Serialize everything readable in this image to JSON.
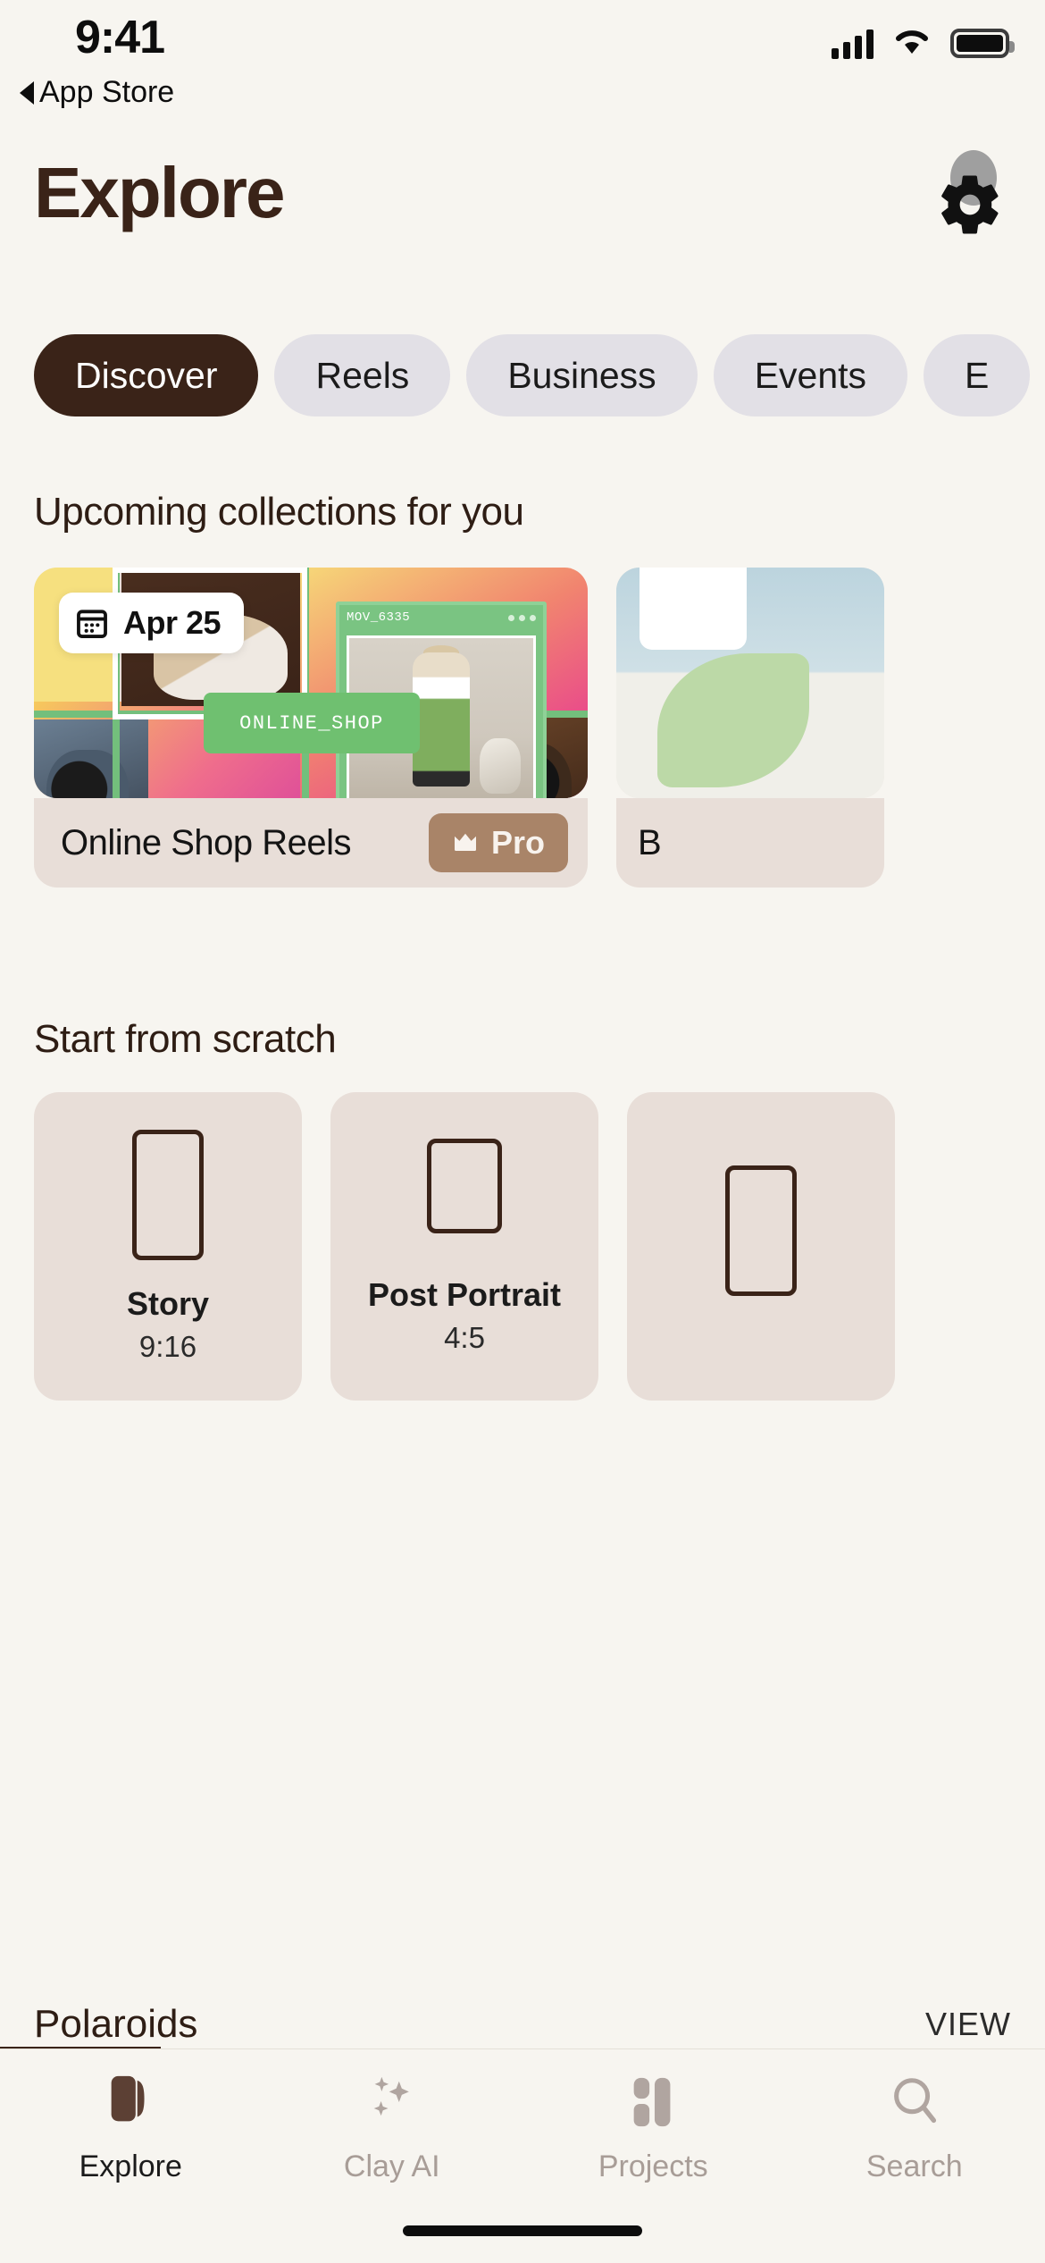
{
  "status_bar": {
    "time": "9:41",
    "back_label": "App Store",
    "back_icon": "triangle-left-icon",
    "signal_icon": "cellular-signal-icon",
    "wifi_icon": "wifi-icon",
    "battery_icon": "battery-full-icon"
  },
  "header": {
    "title": "Explore",
    "settings_icon": "gear-icon"
  },
  "tabs": [
    {
      "label": "Discover",
      "active": true
    },
    {
      "label": "Reels",
      "active": false
    },
    {
      "label": "Business",
      "active": false
    },
    {
      "label": "Events",
      "active": false
    },
    {
      "label": "E",
      "active": false
    }
  ],
  "sections": {
    "upcoming_heading": "Upcoming collections for you",
    "scratch_heading": "Start from scratch"
  },
  "collection_card": {
    "date_badge": {
      "icon": "calendar-icon",
      "label": "Apr 25"
    },
    "overlay_label": "ONLINE_SHOP",
    "window_label": "MOV_6335",
    "title": "Online Shop Reels",
    "badge": {
      "icon": "crown-icon",
      "label": "Pro"
    }
  },
  "collection_card_next": {
    "title": "B"
  },
  "scratch_items": [
    {
      "name": "Story",
      "ratio": "9:16",
      "icon": "portrait-frame-icon"
    },
    {
      "name": "Post Portrait",
      "ratio": "4:5",
      "icon": "portrait-frame-icon"
    },
    {
      "name": "",
      "ratio": "",
      "icon": "portrait-frame-icon"
    }
  ],
  "polaroids": {
    "title": "Polaroids",
    "view_label": "VIEW"
  },
  "bottom_nav": [
    {
      "label": "Explore",
      "icon": "explore-book-icon",
      "active": true
    },
    {
      "label": "Clay AI",
      "icon": "sparkles-icon",
      "active": false
    },
    {
      "label": "Projects",
      "icon": "blocks-icon",
      "active": false
    },
    {
      "label": "Search",
      "icon": "search-icon",
      "active": false
    }
  ],
  "colors": {
    "background": "#f7f5f0",
    "brand_dark": "#3a2318",
    "pill_inactive": "#e2e0e6",
    "card_bg": "#e8ded8",
    "pro_badge": "#a98468",
    "accent_green": "#6fc070",
    "muted_text": "#a89d97"
  }
}
